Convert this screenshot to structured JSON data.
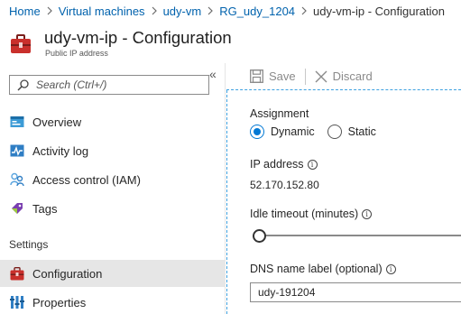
{
  "breadcrumb": {
    "items": [
      "Home",
      "Virtual machines",
      "udy-vm",
      "RG_udy_1204"
    ],
    "current": "udy-vm-ip - Configuration"
  },
  "header": {
    "title": "udy-vm-ip - Configuration",
    "subtitle": "Public IP address",
    "icon": "toolbox-icon"
  },
  "sidebar": {
    "search_placeholder": "Search (Ctrl+/)",
    "collapse_glyph": "«",
    "items": [
      {
        "label": "Overview",
        "icon": "overview-icon"
      },
      {
        "label": "Activity log",
        "icon": "activity-log-icon"
      },
      {
        "label": "Access control (IAM)",
        "icon": "people-icon"
      },
      {
        "label": "Tags",
        "icon": "tag-icon"
      }
    ],
    "section_settings": "Settings",
    "settings_items": [
      {
        "label": "Configuration",
        "icon": "toolbox-icon",
        "selected": true
      },
      {
        "label": "Properties",
        "icon": "properties-icon"
      }
    ]
  },
  "toolbar": {
    "save_label": "Save",
    "discard_label": "Discard"
  },
  "form": {
    "assignment_label": "Assignment",
    "dynamic_label": "Dynamic",
    "static_label": "Static",
    "assignment_selected": "Dynamic",
    "ip_address_label": "IP address",
    "ip_address_value": "52.170.152.80",
    "idle_timeout_label": "Idle timeout (minutes)",
    "idle_timeout_fraction": 0.0,
    "dns_label": "DNS name label (optional)",
    "dns_value": "udy-191204"
  },
  "colors": {
    "link": "#0062ad",
    "accent": "#0078d4",
    "selected_bg": "#e6e6e6",
    "dashed_border": "#3ea1e0",
    "toolbox_red": "#c9302c"
  }
}
